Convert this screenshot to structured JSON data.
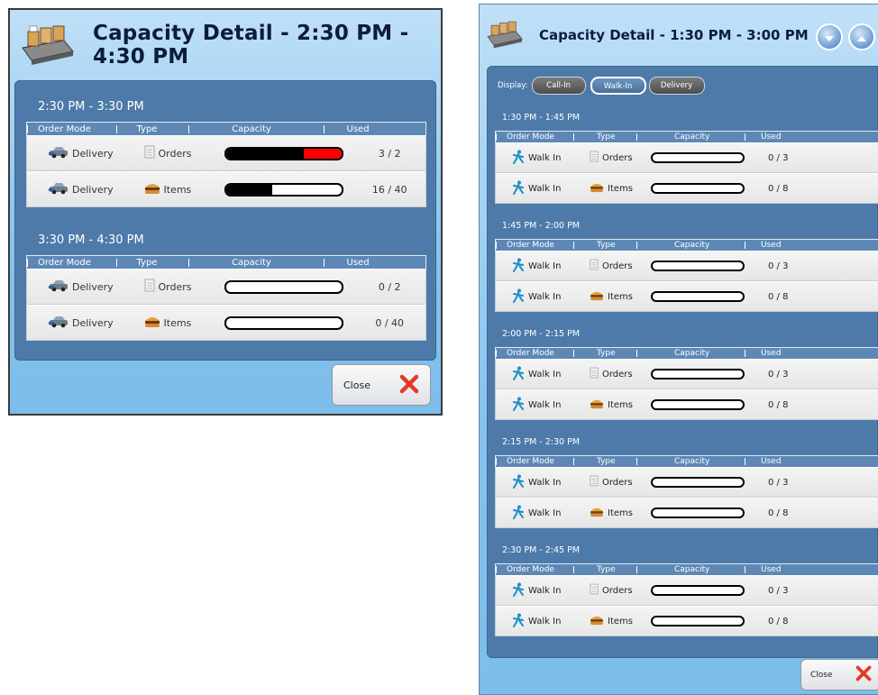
{
  "left_dialog": {
    "title": "Capacity Detail - 2:30 PM - 4:30 PM",
    "columns": [
      "Order Mode",
      "Type",
      "Capacity",
      "Used"
    ],
    "slots": [
      {
        "title": "2:30 PM - 3:30 PM",
        "rows": [
          {
            "mode": "Delivery",
            "type": "Orders",
            "used": "3 / 2",
            "fill_fraction": 1.0,
            "over_fraction": 0.33
          },
          {
            "mode": "Delivery",
            "type": "Items",
            "used": "16 / 40",
            "fill_fraction": 0.4,
            "over_fraction": 0
          }
        ]
      },
      {
        "title": "3:30 PM - 4:30 PM",
        "rows": [
          {
            "mode": "Delivery",
            "type": "Orders",
            "used": "0 / 2",
            "fill_fraction": 0,
            "over_fraction": 0
          },
          {
            "mode": "Delivery",
            "type": "Items",
            "used": "0 / 40",
            "fill_fraction": 0,
            "over_fraction": 0
          }
        ]
      }
    ],
    "close_label": "Close"
  },
  "right_dialog": {
    "title": "Capacity Detail - 1:30 PM - 3:00 PM",
    "display_label": "Display:",
    "filters": [
      {
        "label": "Call-In",
        "active": false
      },
      {
        "label": "Walk-In",
        "active": true
      },
      {
        "label": "Delivery",
        "active": false
      }
    ],
    "columns": [
      "Order Mode",
      "Type",
      "Capacity",
      "Used"
    ],
    "slots": [
      {
        "title": "1:30 PM - 1:45 PM",
        "rows": [
          {
            "mode": "Walk In",
            "type": "Orders",
            "used": "0 / 3"
          },
          {
            "mode": "Walk In",
            "type": "Items",
            "used": "0 / 8"
          }
        ]
      },
      {
        "title": "1:45 PM - 2:00 PM",
        "rows": [
          {
            "mode": "Walk In",
            "type": "Orders",
            "used": "0 / 3"
          },
          {
            "mode": "Walk In",
            "type": "Items",
            "used": "0 / 8"
          }
        ]
      },
      {
        "title": "2:00 PM - 2:15 PM",
        "rows": [
          {
            "mode": "Walk In",
            "type": "Orders",
            "used": "0 / 3"
          },
          {
            "mode": "Walk In",
            "type": "Items",
            "used": "0 / 8"
          }
        ]
      },
      {
        "title": "2:15 PM - 2:30 PM",
        "rows": [
          {
            "mode": "Walk In",
            "type": "Orders",
            "used": "0 / 3"
          },
          {
            "mode": "Walk In",
            "type": "Items",
            "used": "0 / 8"
          }
        ]
      },
      {
        "title": "2:30 PM - 2:45 PM",
        "rows": [
          {
            "mode": "Walk In",
            "type": "Orders",
            "used": "0 / 3"
          },
          {
            "mode": "Walk In",
            "type": "Items",
            "used": "0 / 8"
          }
        ]
      }
    ],
    "close_label": "Close"
  },
  "icons": {
    "app_logo": "food-tray-icon",
    "delivery": "delivery-car-icon",
    "walk_in": "walking-person-icon",
    "orders": "document-icon",
    "items": "burger-icon",
    "close": "red-x-icon",
    "scroll_down": "chevron-down-icon",
    "scroll_up": "chevron-up-icon"
  },
  "colors": {
    "panel": "#4e7aa9",
    "bar_fill": "#000000",
    "bar_over": "#ff0000",
    "close_x": "#e23b2a"
  }
}
